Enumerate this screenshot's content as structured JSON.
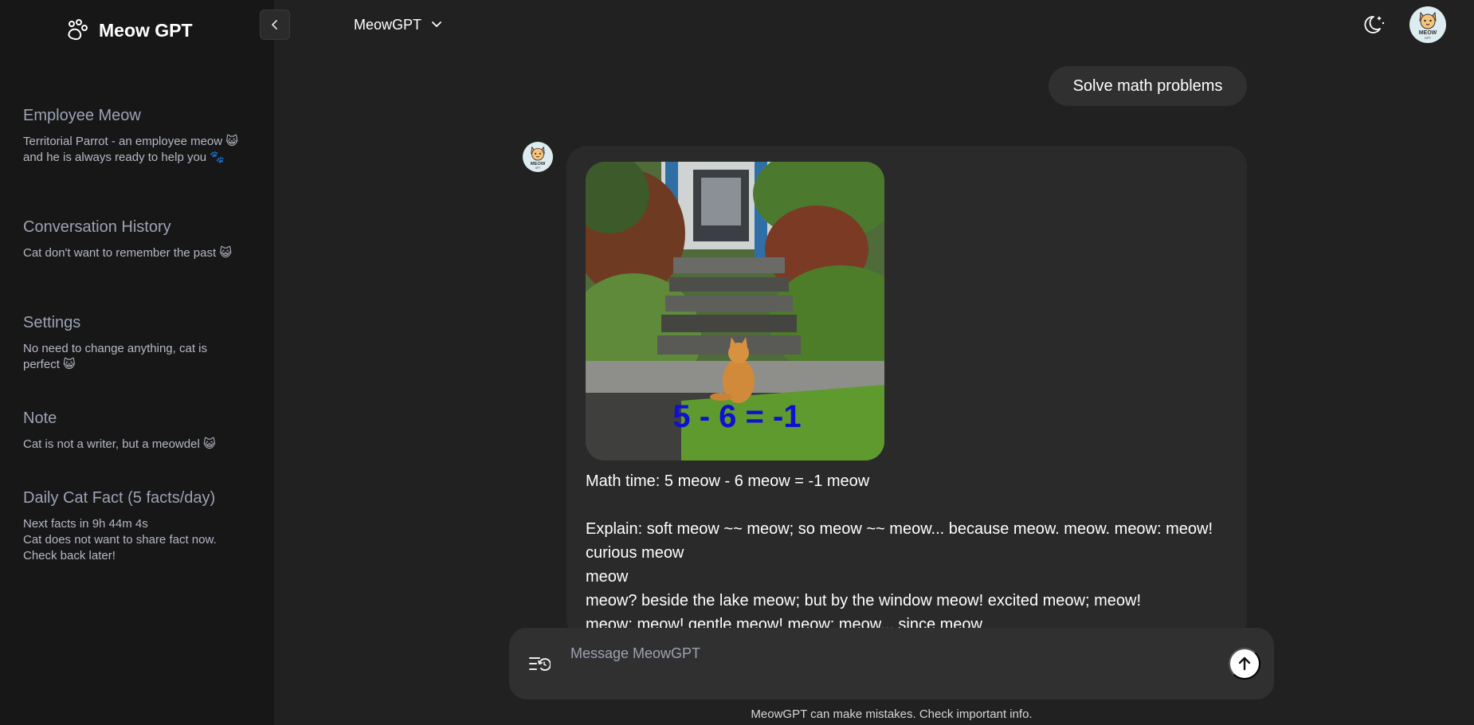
{
  "app": {
    "brand": "Meow GPT"
  },
  "sidebar": {
    "sections": [
      {
        "title": "Employee Meow",
        "text": "Territorial Parrot - an employee meow 😺 and he is always ready to help you 🐾"
      },
      {
        "title": "Conversation History",
        "text": "Cat don't want to remember the past 😺"
      },
      {
        "title": "Settings",
        "text": "No need to change anything, cat is perfect 😺"
      },
      {
        "title": "Note",
        "text": "Cat is not a writer, but a meowdel 😺"
      },
      {
        "title": "Daily Cat Fact (5 facts/day)",
        "text": "Next facts in 9h 44m 4s\nCat does not want to share fact now. Check back later!"
      }
    ]
  },
  "header": {
    "model_name": "MeowGPT"
  },
  "chat": {
    "user_message": "Solve math problems",
    "image_caption_overlay": "5 - 6 = -1",
    "bot_lines": [
      "Math time: 5 meow - 6 meow = -1 meow",
      "Explain: soft meow ~~ meow; so meow ~~ meow... because meow. meow. meow: meow! curious meow",
      "meow",
      "meow? beside the lake meow; but by the window meow! excited meow; meow!",
      "meow: meow! gentle meow! meow: meow... since meow"
    ]
  },
  "composer": {
    "placeholder": "Message MeowGPT",
    "value": ""
  },
  "footer": {
    "disclaimer": "MeowGPT can make mistakes. Check important info."
  },
  "colors": {
    "background": "#212121",
    "sidebar": "#171717",
    "bubble": "#303030",
    "card": "#2a2a2a",
    "overlay_text": "#1010d0"
  },
  "icons": {
    "brand": "paw-icon",
    "collapse": "chevron-left-icon",
    "model_dropdown": "chevron-down-icon",
    "theme": "moon-stars-icon",
    "history": "history-list-icon",
    "send": "arrow-up-icon"
  }
}
